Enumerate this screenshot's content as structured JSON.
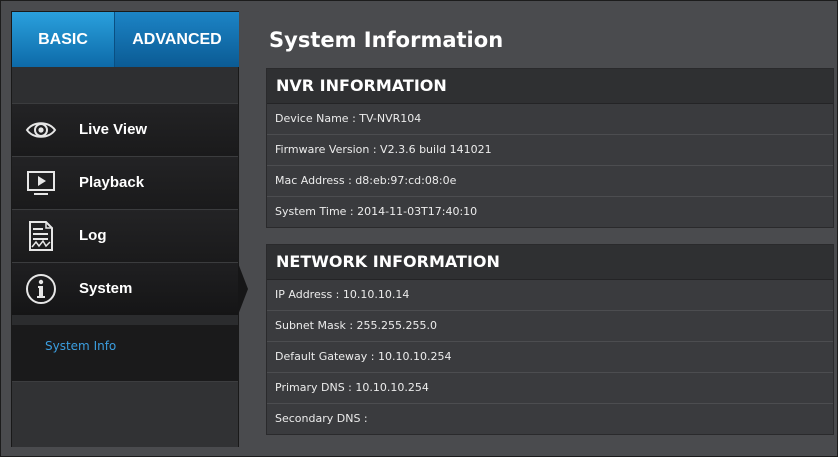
{
  "sidebar": {
    "tabs": [
      {
        "label": "BASIC"
      },
      {
        "label": "ADVANCED"
      }
    ],
    "items": [
      {
        "label": "Live View",
        "icon": "eye-icon"
      },
      {
        "label": "Playback",
        "icon": "playback-monitor-icon"
      },
      {
        "label": "Log",
        "icon": "log-document-icon"
      },
      {
        "label": "System",
        "icon": "info-icon"
      }
    ],
    "submenu": [
      {
        "label": "System Info"
      }
    ]
  },
  "main": {
    "title": "System Information",
    "nvr": {
      "header": "NVR INFORMATION",
      "rows": [
        "Device Name : TV-NVR104",
        "Firmware Version : V2.3.6 build 141021",
        "Mac Address : d8:eb:97:cd:08:0e",
        "System Time : 2014-11-03T17:40:10"
      ]
    },
    "network": {
      "header": "NETWORK INFORMATION",
      "rows": [
        "IP Address : 10.10.10.14",
        "Subnet Mask : 255.255.255.0",
        "Default Gateway : 10.10.10.254",
        "Primary DNS : 10.10.10.254",
        "Secondary DNS :"
      ]
    }
  },
  "colors": {
    "accent": "#1a8ad0",
    "link": "#3b9ee0",
    "background": "#4a4b4e"
  }
}
